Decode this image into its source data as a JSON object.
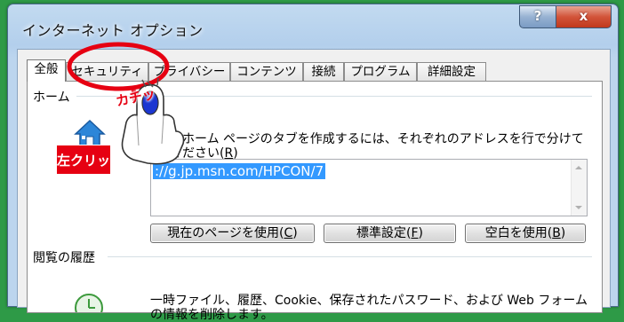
{
  "window": {
    "title": "インターネット オプション",
    "help_label": "?",
    "close_label": "x"
  },
  "tabs": [
    {
      "label": "全般",
      "active": true
    },
    {
      "label": "セキュリティ",
      "active": false
    },
    {
      "label": "プライバシー",
      "active": false
    },
    {
      "label": "コンテンツ",
      "active": false
    },
    {
      "label": "接続",
      "active": false
    },
    {
      "label": "プログラム",
      "active": false
    },
    {
      "label": "詳細設定",
      "active": false
    }
  ],
  "home": {
    "section_label": "ホーム",
    "description_line1": "のホーム ページのタブを作成するには、それぞれのアドレスを行で分けて",
    "description_line2": "ください(",
    "description_key": "R",
    "description_end": ")",
    "url_value": "://g.jp.msn.com/HPCON/7",
    "use_current_label": "現在のページを使用(",
    "use_current_key": "C",
    "use_default_label": "標準設定(",
    "use_default_key": "F",
    "use_blank_label": "空白を使用(",
    "use_blank_key": "B"
  },
  "history": {
    "section_label": "閲覧の履歴",
    "description_line1": "一時ファイル、履歴、Cookie、保存されたパスワード、および Web フォーム",
    "description_line2": "の情報を削除します。"
  },
  "annotations": {
    "left_click": "左クリック",
    "click_sound": "カチッ"
  },
  "colors": {
    "background": "#2e9a47",
    "selection": "#3399ff",
    "annotation_red": "#e60012"
  }
}
